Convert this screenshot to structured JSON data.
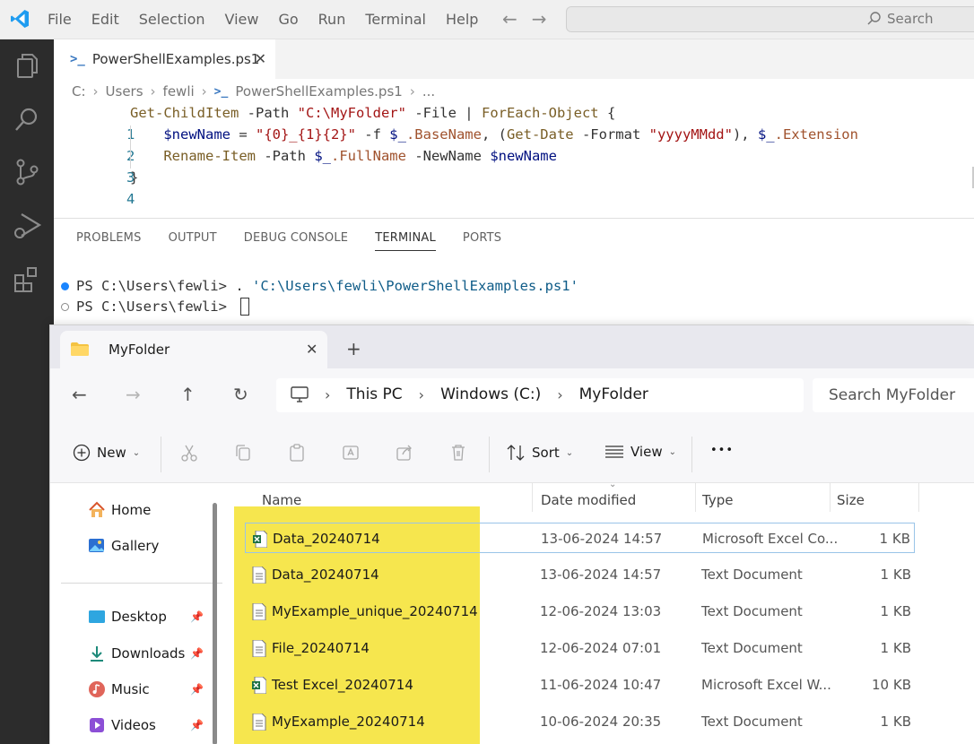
{
  "vscode": {
    "menu": [
      "File",
      "Edit",
      "Selection",
      "View",
      "Go",
      "Run",
      "Terminal",
      "Help"
    ],
    "search_label": "Search",
    "tab": {
      "label": "PowerShellExamples.ps1",
      "close": "✕"
    },
    "breadcrumb": [
      "C:",
      "Users",
      "fewli",
      "PowerShellExamples.ps1",
      "..."
    ],
    "code": {
      "line_numbers": [
        "1",
        "2",
        "3",
        "4"
      ],
      "l1": {
        "cmd": "Get-ChildItem",
        "p1": " -Path ",
        "s1": "\"C:\\MyFolder\"",
        "p2": " -File | ",
        "cmd2": "ForEach-Object",
        "p3": " {"
      },
      "l2": {
        "v1": "$newName",
        "p1": " = ",
        "s1": "\"{0}_{1}{2}\"",
        "p2": " -f ",
        "v2": "$_",
        "pr1": ".BaseName",
        "p3": ", (",
        "cmd": "Get-Date",
        "p4": " -Format ",
        "s2": "\"yyyyMMdd\"",
        "p5": "), ",
        "v3": "$_",
        "pr2": ".Extension"
      },
      "l3": {
        "cmd": "Rename-Item",
        "p1": " -Path ",
        "v1": "$_",
        "pr1": ".FullName",
        "p2": " -NewName ",
        "v2": "$newName"
      },
      "l4": {
        "p1": "}"
      }
    },
    "panel_tabs": [
      "PROBLEMS",
      "OUTPUT",
      "DEBUG CONSOLE",
      "TERMINAL",
      "PORTS"
    ],
    "terminal": {
      "line1_prompt": "PS C:\\Users\\fewli> ",
      "line1_cmd": ". ",
      "line1_path": "'C:\\Users\\fewli\\PowerShellExamples.ps1'",
      "line2_prompt": "PS C:\\Users\\fewli> "
    }
  },
  "explorer": {
    "tab_label": "MyFolder",
    "tab_close": "✕",
    "new_tab": "+",
    "address": [
      "This PC",
      "Windows (C:)",
      "MyFolder"
    ],
    "search_placeholder": "Search MyFolder",
    "commands": {
      "new": "New",
      "sort": "Sort",
      "view": "View",
      "more": "•••"
    },
    "nav": [
      "Home",
      "Gallery",
      "Desktop",
      "Downloads",
      "Music",
      "Videos"
    ],
    "columns": [
      "Name",
      "Date modified",
      "Type",
      "Size"
    ],
    "files": [
      {
        "name": "Data_20240714",
        "date": "13-06-2024 14:57",
        "type": "Microsoft Excel Co...",
        "size": "1 KB",
        "icon": "excel-icon"
      },
      {
        "name": "Data_20240714",
        "date": "13-06-2024 14:57",
        "type": "Text Document",
        "size": "1 KB",
        "icon": "text-file-icon"
      },
      {
        "name": "MyExample_unique_20240714",
        "date": "12-06-2024 13:03",
        "type": "Text Document",
        "size": "1 KB",
        "icon": "text-file-icon"
      },
      {
        "name": "File_20240714",
        "date": "12-06-2024 07:01",
        "type": "Text Document",
        "size": "1 KB",
        "icon": "text-file-icon"
      },
      {
        "name": "Test Excel_20240714",
        "date": "11-06-2024 10:47",
        "type": "Microsoft Excel W...",
        "size": "10 KB",
        "icon": "excel-icon"
      },
      {
        "name": "MyExample_20240714",
        "date": "10-06-2024 20:35",
        "type": "Text Document",
        "size": "1 KB",
        "icon": "text-file-icon"
      }
    ],
    "highlight_color": "#f6e64e"
  }
}
